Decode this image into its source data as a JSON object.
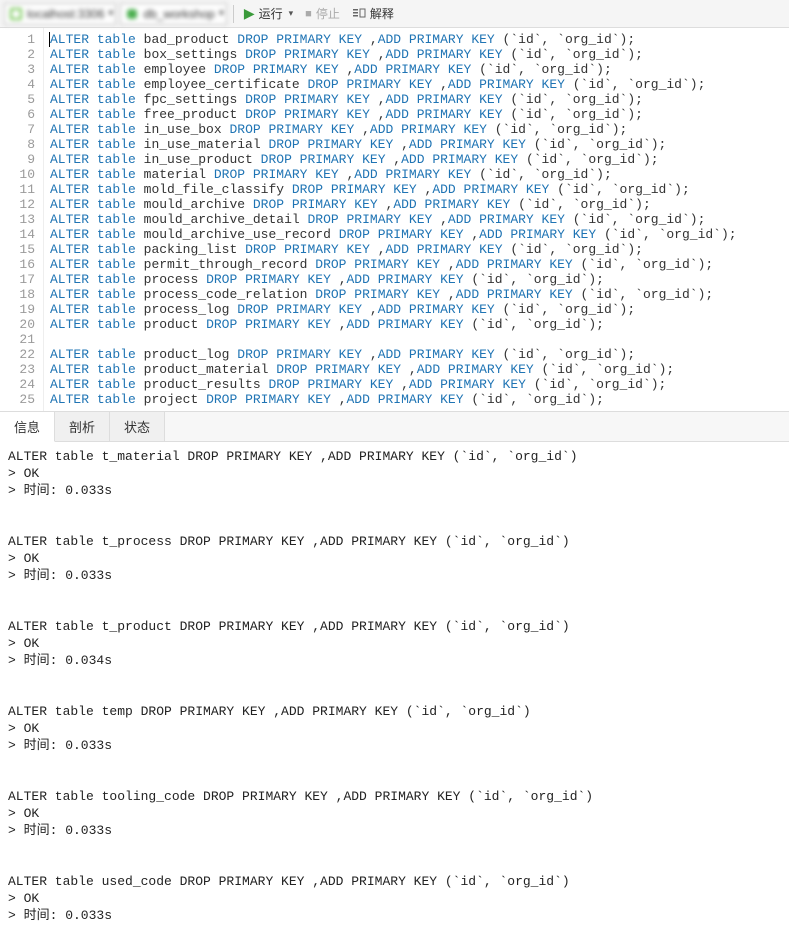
{
  "toolbar": {
    "connection_label": "localhost:3306",
    "database_label": "db_workshop",
    "run_label": "运行",
    "stop_label": "停止",
    "explain_label": "解释"
  },
  "sql_keywords": {
    "alter": "ALTER",
    "table": "table",
    "drop_pk": "DROP PRIMARY KEY",
    "add_pk": "ADD PRIMARY KEY"
  },
  "sql_lines": [
    {
      "tbl": "bad_product",
      "tail": " (`id`, `org_id`);"
    },
    {
      "tbl": "box_settings",
      "tail": " (`id`, `org_id`);"
    },
    {
      "tbl": "employee",
      "tail": " (`id`, `org_id`);"
    },
    {
      "tbl": "employee_certificate",
      "tail": " (`id`, `org_id`);"
    },
    {
      "tbl": "fpc_settings",
      "tail": " (`id`, `org_id`);"
    },
    {
      "tbl": "free_product",
      "tail": " (`id`, `org_id`);"
    },
    {
      "tbl": "in_use_box",
      "tail": " (`id`, `org_id`);"
    },
    {
      "tbl": "in_use_material",
      "tail": " (`id`, `org_id`);"
    },
    {
      "tbl": "in_use_product",
      "tail": " (`id`, `org_id`);"
    },
    {
      "tbl": "material",
      "tail": " (`id`, `org_id`);"
    },
    {
      "tbl": "mold_file_classify",
      "tail": " (`id`, `org_id`);"
    },
    {
      "tbl": "mould_archive",
      "tail": " (`id`, `org_id`);"
    },
    {
      "tbl": "mould_archive_detail",
      "tail": " (`id`, `org_id`);"
    },
    {
      "tbl": "mould_archive_use_record",
      "tail": " (`id`, `org_id`);"
    },
    {
      "tbl": "packing_list",
      "tail": " (`id`, `org_id`);"
    },
    {
      "tbl": "permit_through_record",
      "tail": " (`id`, `org_id`);"
    },
    {
      "tbl": "process",
      "tail": " (`id`, `org_id`);"
    },
    {
      "tbl": "process_code_relation",
      "tail": " (`id`, `org_id`);"
    },
    {
      "tbl": "process_log",
      "tail": " (`id`, `org_id`);"
    },
    {
      "tbl": "product",
      "tail": " (`id`, `org_id`);"
    },
    {
      "blank": true
    },
    {
      "tbl": "product_log",
      "tail": " (`id`, `org_id`);"
    },
    {
      "tbl": "product_material",
      "tail": " (`id`, `org_id`);"
    },
    {
      "tbl": "product_results",
      "tail": " (`id`, `org_id`);"
    },
    {
      "tbl": "project",
      "tail": " (`id`, `org_id`);"
    }
  ],
  "tabs": {
    "info": "信息",
    "profile": "剖析",
    "status": "状态"
  },
  "output_labels": {
    "ok": "> OK",
    "time_prefix": "> 时间: "
  },
  "output": [
    {
      "stmt": "ALTER table t_material DROP PRIMARY KEY ,ADD PRIMARY KEY (`id`, `org_id`)",
      "time": "0.033s"
    },
    {
      "stmt": "ALTER table t_process DROP PRIMARY KEY ,ADD PRIMARY KEY (`id`, `org_id`)",
      "time": "0.033s"
    },
    {
      "stmt": "ALTER table t_product DROP PRIMARY KEY ,ADD PRIMARY KEY (`id`, `org_id`)",
      "time": "0.034s"
    },
    {
      "stmt": "ALTER table temp DROP PRIMARY KEY ,ADD PRIMARY KEY (`id`, `org_id`)",
      "time": "0.033s"
    },
    {
      "stmt": "ALTER table tooling_code DROP PRIMARY KEY ,ADD PRIMARY KEY (`id`, `org_id`)",
      "time": "0.033s"
    },
    {
      "stmt": "ALTER table used_code DROP PRIMARY KEY ,ADD PRIMARY KEY (`id`, `org_id`)",
      "time": "0.033s"
    }
  ]
}
